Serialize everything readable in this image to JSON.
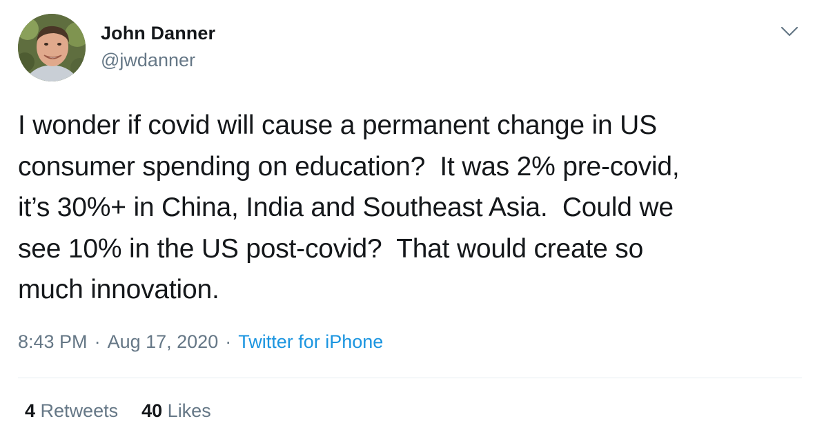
{
  "user": {
    "display_name": "John Danner",
    "handle": "@jwdanner"
  },
  "tweet": {
    "text": "I wonder if covid will cause a permanent change in US\nconsumer spending on education?  It was 2% pre-covid,\nit’s 30%+ in China, India and Southeast Asia.  Could we\nsee 10% in the US post-covid?  That would create so\nmuch innovation.",
    "time": "8:43 PM",
    "date": "Aug 17, 2020",
    "separator": "·",
    "source": "Twitter for iPhone"
  },
  "stats": {
    "retweets_count": "4",
    "retweets_label": "Retweets",
    "likes_count": "40",
    "likes_label": "Likes"
  },
  "icons": {
    "avatar": "profile-photo",
    "caret": "chevron-down-icon"
  },
  "colors": {
    "text": "#14171a",
    "secondary": "#657786",
    "link": "#1b95e0",
    "divider": "#e6ecf0"
  }
}
